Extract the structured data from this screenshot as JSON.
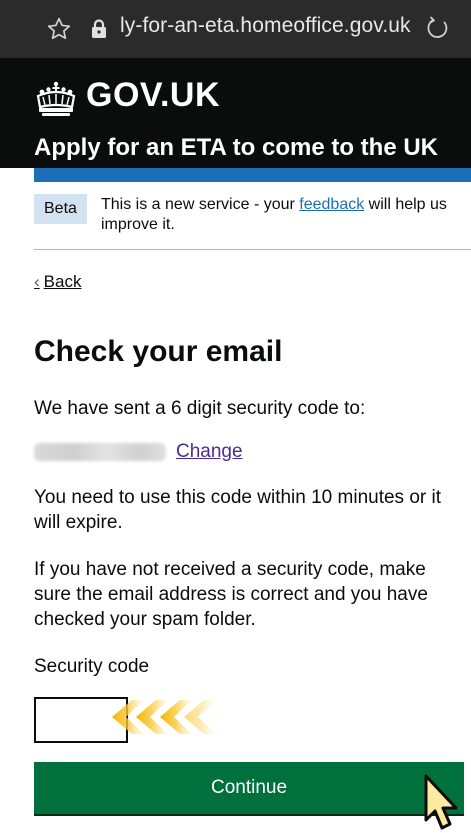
{
  "browser": {
    "url": "ly-for-an-eta.homeoffice.gov.uk",
    "icons": [
      "star-icon",
      "lock-icon",
      "reload-icon"
    ]
  },
  "header": {
    "logo_text": "GOV.UK",
    "service_name": "Apply for an ETA to come to the UK",
    "colors": {
      "header_bg": "#0b0c0c",
      "accent_bar": "#1d70b8"
    }
  },
  "phase_banner": {
    "tag": "Beta",
    "text_before": "This is a new service - your ",
    "link": "feedback",
    "text_after": " will help us improve it."
  },
  "back_link": {
    "label": "Back"
  },
  "page": {
    "title": "Check your email",
    "sent_to_text": "We have sent a 6 digit security code to:",
    "change_link": "Change",
    "expiry_text": "You need to use this code within 10 minutes or it will expire.",
    "help_text": "If you have not received a security code, make sure the email address is correct and you have checked your spam folder."
  },
  "form": {
    "label": "Security code",
    "value": "",
    "continue_label": "Continue",
    "colors": {
      "button": "#00703c"
    }
  }
}
